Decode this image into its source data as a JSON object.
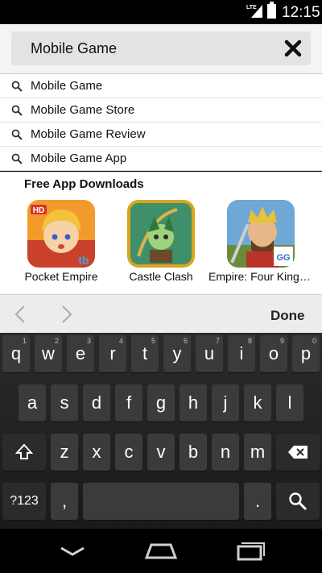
{
  "status_bar": {
    "network": "LTE",
    "time": "12:15"
  },
  "search": {
    "query": "Mobile Game",
    "clear_icon": "close-icon"
  },
  "suggestions": [
    {
      "text": "Mobile Game"
    },
    {
      "text": "Mobile Game Store"
    },
    {
      "text": "Mobile Game Review"
    },
    {
      "text": "Mobile Game App"
    }
  ],
  "apps": {
    "title": "Free App Downloads",
    "items": [
      {
        "name": "Pocket Empire",
        "badge": "HD",
        "corner": "tb"
      },
      {
        "name": "Castle Clash"
      },
      {
        "name": "Empire: Four Kingdoms",
        "corner": "GG"
      }
    ]
  },
  "keyboard_toolbar": {
    "done_label": "Done"
  },
  "keyboard": {
    "row1": [
      {
        "k": "q",
        "h": "1"
      },
      {
        "k": "w",
        "h": "2"
      },
      {
        "k": "e",
        "h": "3"
      },
      {
        "k": "r",
        "h": "4"
      },
      {
        "k": "t",
        "h": "5"
      },
      {
        "k": "y",
        "h": "6"
      },
      {
        "k": "u",
        "h": "7"
      },
      {
        "k": "i",
        "h": "8"
      },
      {
        "k": "o",
        "h": "9"
      },
      {
        "k": "p",
        "h": "0"
      }
    ],
    "row2": [
      "a",
      "s",
      "d",
      "f",
      "g",
      "h",
      "j",
      "k",
      "l"
    ],
    "row3": [
      "z",
      "x",
      "c",
      "v",
      "b",
      "n",
      "m"
    ],
    "symbols_label": "?123",
    "comma": ",",
    "period": "."
  },
  "colors": {
    "accent": "#f4f4f4",
    "keyboard_bg": "#1a1a1a",
    "key": "#3b3b3b"
  }
}
